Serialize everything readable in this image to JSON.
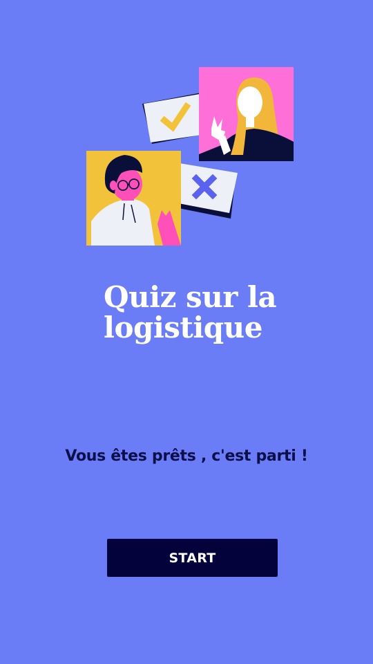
{
  "quiz": {
    "title_line1": "Quiz sur la",
    "title_line2": "logistique",
    "subtitle": "Vous êtes prêts , c'est parti !",
    "start_label": "START"
  },
  "illustration": {
    "check_icon": "check-icon",
    "cross_icon": "cross-icon"
  },
  "colors": {
    "background": "#6a7df7",
    "button": "#03023a",
    "subtitle_text": "#0c0f4a",
    "card_yellow": "#f2c23a",
    "card_pink": "#ff6fd8",
    "card_light": "#eef0f7",
    "dark_navy": "#0a0f3a"
  }
}
